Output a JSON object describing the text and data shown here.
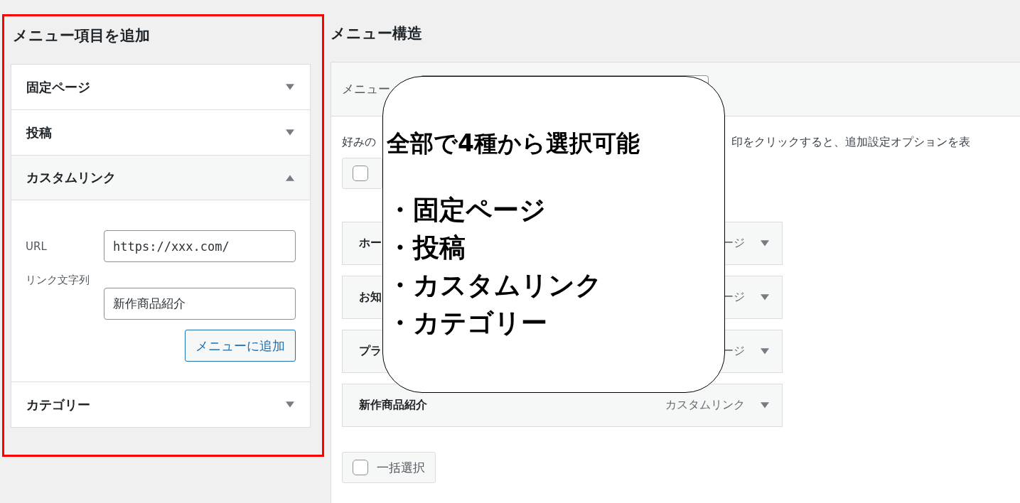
{
  "left_panel": {
    "title": "メニュー項目を追加",
    "sections": [
      {
        "title": "固定ページ",
        "expanded": false
      },
      {
        "title": "投稿",
        "expanded": false
      },
      {
        "title": "カスタムリンク",
        "expanded": true,
        "fields": [
          {
            "label": "URL",
            "value": "https://xxx.com/",
            "kind": "url"
          },
          {
            "label": "リンク文字列",
            "value": "新作商品紹介",
            "kind": "text"
          }
        ],
        "button": "メニューに追加"
      },
      {
        "title": "カテゴリー",
        "expanded": false
      }
    ]
  },
  "right_panel": {
    "title": "メニュー構造",
    "name_label": "メニュー",
    "instruction_start": "好みの",
    "instruction_end": "印をクリックすると、追加設定オプションを表",
    "top_bulk_select": {
      "checked": false
    },
    "menu_items": [
      {
        "title": "ホー",
        "type": "ージ"
      },
      {
        "title": "お知",
        "type": "ージ"
      },
      {
        "title": "プラ",
        "type": "ージ"
      },
      {
        "title": "新作商品紹介",
        "type": "カスタムリンク"
      }
    ],
    "bulk_select": {
      "label": "一括選択",
      "checked": false
    }
  },
  "callout": {
    "title": "全部で4種から選択可能",
    "items": [
      "・固定ページ",
      "・投稿",
      "・カスタムリンク",
      "・カテゴリー"
    ]
  }
}
